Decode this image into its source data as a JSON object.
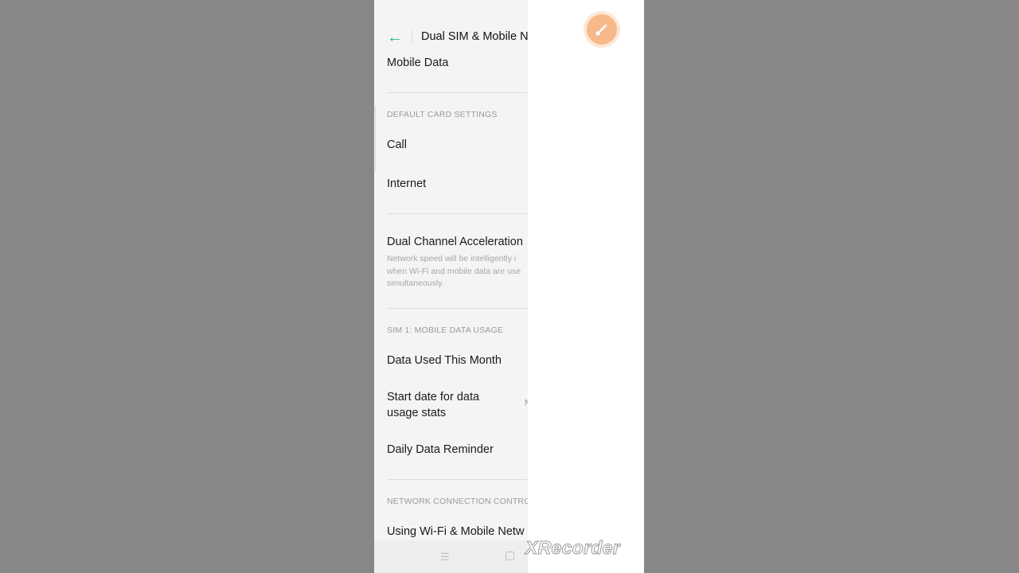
{
  "header": {
    "title": "Dual SIM & Mobile N"
  },
  "sections": {
    "top_item": "Mobile Data",
    "default_card": {
      "header": "DEFAULT CARD SETTINGS",
      "items": [
        "Call",
        "Internet"
      ]
    },
    "dual_channel": {
      "label": "Dual Channel Acceleration",
      "desc_lines": [
        "Network speed will be intelligently i",
        "when Wi-Fi and mobile data are use",
        "simultaneously."
      ]
    },
    "sim1_usage": {
      "header": "SIM 1: MOBILE DATA USAGE",
      "items": [
        "Data Used This Month",
        "Start date for data",
        "usage stats",
        "Daily Data Reminder"
      ],
      "trailing": "N"
    },
    "network": {
      "header": "NETWORK CONNECTION CONTRO",
      "item": "Using Wi-Fi & Mobile Netw"
    }
  },
  "navbar": {
    "menu_glyph": "☰"
  },
  "watermark": "XRecorder",
  "icons": {
    "back": "arrow-left-icon",
    "fab": "paintbrush-icon"
  },
  "colors": {
    "accent": "#2fb872",
    "fab": "#f7b98a"
  }
}
